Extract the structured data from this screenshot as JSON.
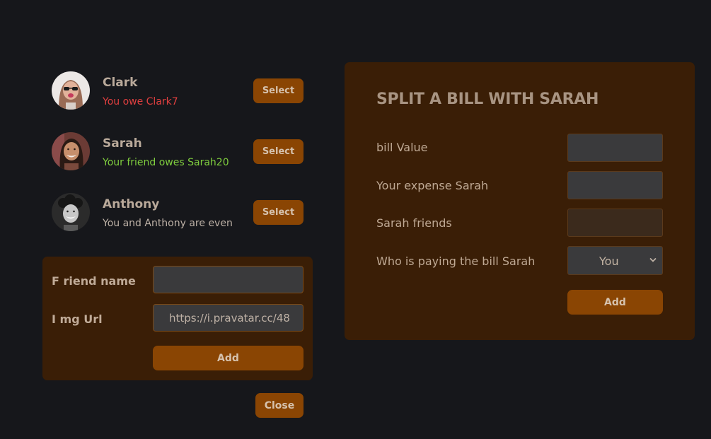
{
  "friends": [
    {
      "name": "Clark",
      "status": "You owe Clark7",
      "status_type": "owe",
      "select_label": "Select",
      "avatar_icon": "woman-sunglasses-avatar"
    },
    {
      "name": "Sarah",
      "status": "Your friend owes Sarah20",
      "status_type": "owed",
      "select_label": "Select",
      "avatar_icon": "woman-smiling-avatar"
    },
    {
      "name": "Anthony",
      "status": "You and Anthony are even",
      "status_type": "even",
      "select_label": "Select",
      "avatar_icon": "man-curly-hair-avatar"
    }
  ],
  "add_friend": {
    "name_label": "F riend name",
    "name_value": "",
    "img_label": "I mg Url",
    "img_value": "https://i.pravatar.cc/48",
    "add_label": "Add"
  },
  "close_label": "Close",
  "split": {
    "title": "SPLIT A BILL WITH SARAH",
    "bill_label": "bill Value",
    "bill_value": "",
    "expense_label": "Your expense Sarah",
    "expense_value": "",
    "friend_label": "Sarah friends",
    "friend_value": "",
    "payer_label": "Who is paying the bill Sarah",
    "payer_value": "You",
    "add_label": "Add"
  },
  "colors": {
    "background": "#16171b",
    "panel": "#3a1e06",
    "button": "#8a4503",
    "owe": "#e03f3f",
    "owed": "#7fce3e",
    "even": "#bdb1a6"
  }
}
